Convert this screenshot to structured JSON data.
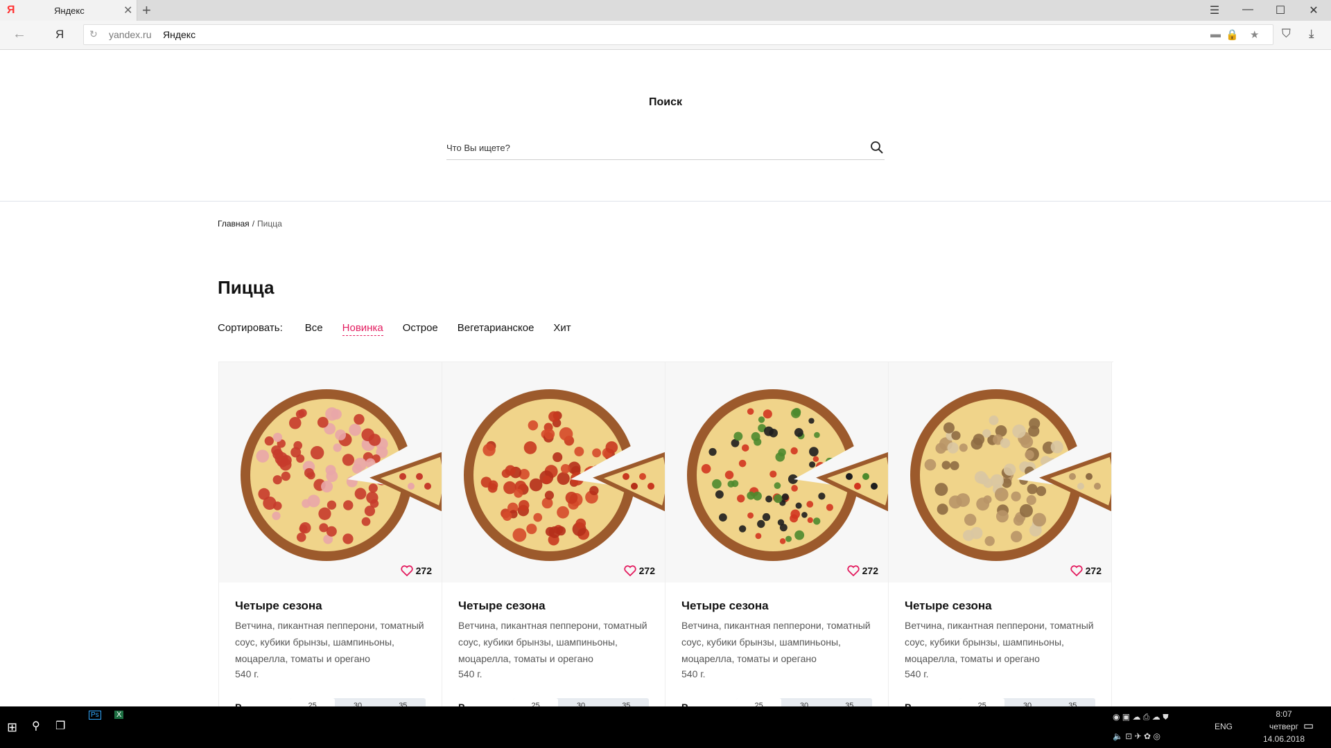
{
  "browser": {
    "tab_logo": "Я",
    "tab_title": "Яндекс",
    "tab_close": "✕",
    "new_tab": "+",
    "back_icon": "←",
    "yandex_button": "Я",
    "reload_icon": "↻",
    "domain": "yandex.ru",
    "page_title": "Яндекс",
    "window_controls": [
      "☰",
      "—",
      "☐",
      "✕"
    ]
  },
  "header": {
    "search_title": "Поиск",
    "search_placeholder": "Что Вы ищете?"
  },
  "breadcrumb": {
    "home": "Главная",
    "separator": "/",
    "current": "Пицца"
  },
  "page": {
    "title": "Пицца",
    "sort_label": "Сортировать:",
    "sort_options": [
      "Все",
      "Новинка",
      "Острое",
      "Вегетарианское",
      "Хит"
    ],
    "sort_active": "Новинка"
  },
  "products": [
    {
      "name": "Четыре сезона",
      "desc": "Ветчина, пикантная пепперони, томатный соус, кубики брынзы, шампиньоны, моцарелла, томаты и орегано",
      "weight": "540 г.",
      "likes": "272",
      "price_prefix": "Р",
      "sizes": [
        "25",
        "30",
        "35"
      ]
    },
    {
      "name": "Четыре сезона",
      "desc": "Ветчина, пикантная пепперони, томатный соус, кубики брынзы, шампиньоны, моцарелла, томаты и орегано",
      "weight": "540 г.",
      "likes": "272",
      "price_prefix": "Р",
      "sizes": [
        "25",
        "30",
        "35"
      ]
    },
    {
      "name": "Четыре сезона",
      "desc": "Ветчина, пикантная пепперони, томатный соус, кубики брынзы, шампиньоны, моцарелла, томаты и орегано",
      "weight": "540 г.",
      "likes": "272",
      "price_prefix": "Р",
      "sizes": [
        "25",
        "30",
        "35"
      ]
    },
    {
      "name": "Четыре сезона",
      "desc": "Ветчина, пикантная пепперони, томатный соус, кубики брынзы, шампиньоны, моцарелла, томаты и орегано",
      "weight": "540 г.",
      "likes": "272",
      "price_prefix": "Р",
      "sizes": [
        "25",
        "30",
        "35"
      ]
    }
  ],
  "taskbar": {
    "lang": "ENG",
    "time": "8:07",
    "day": "четверг",
    "date": "14.06.2018"
  },
  "colors": {
    "accent": "#e31c5f",
    "topping_variants": [
      "ham-pepperoni",
      "pepperoni",
      "vegetable-olive",
      "mushroom"
    ]
  }
}
